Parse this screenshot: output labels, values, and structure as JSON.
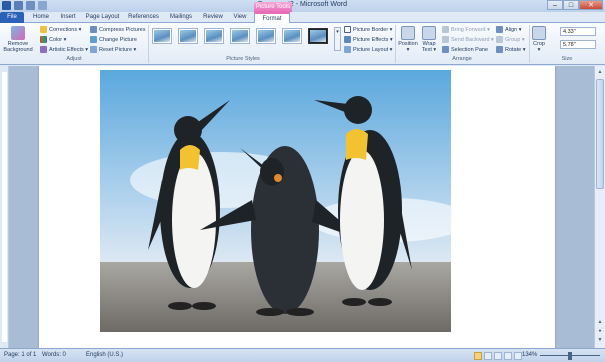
{
  "window": {
    "title": "Document2 - Microsoft Word",
    "context_tab": "Picture Tools",
    "min": "–",
    "max": "□",
    "close": "✕"
  },
  "tabs": [
    "File",
    "Home",
    "Insert",
    "Page Layout",
    "References",
    "Mailings",
    "Review",
    "View",
    "Format"
  ],
  "ribbon": {
    "adjust": {
      "remove_bg": "Remove Background",
      "corrections": "Corrections ▾",
      "color": "Color ▾",
      "artistic": "Artistic Effects ▾",
      "compress": "Compress Pictures",
      "change": "Change Picture",
      "reset": "Reset Picture ▾",
      "label": "Adjust"
    },
    "styles": {
      "label": "Picture Styles",
      "border": "Picture Border ▾",
      "effects": "Picture Effects ▾",
      "layout": "Picture Layout ▾"
    },
    "arrange": {
      "position": "Position ▾",
      "wrap": "Wrap Text ▾",
      "bring_forward": "Bring Forward ▾",
      "send_backward": "Send Backward ▾",
      "selection_pane": "Selection Pane",
      "align": "Align ▾",
      "group": "Group ▾",
      "rotate": "Rotate ▾",
      "label": "Arrange"
    },
    "size": {
      "crop": "Crop ▾",
      "height": "4.33\"",
      "width": "5.78\"",
      "label": "Size"
    }
  },
  "status": {
    "page": "Page: 1 of 1",
    "words": "Words: 0",
    "lang": "English (U.S.)",
    "zoom": "134%"
  }
}
